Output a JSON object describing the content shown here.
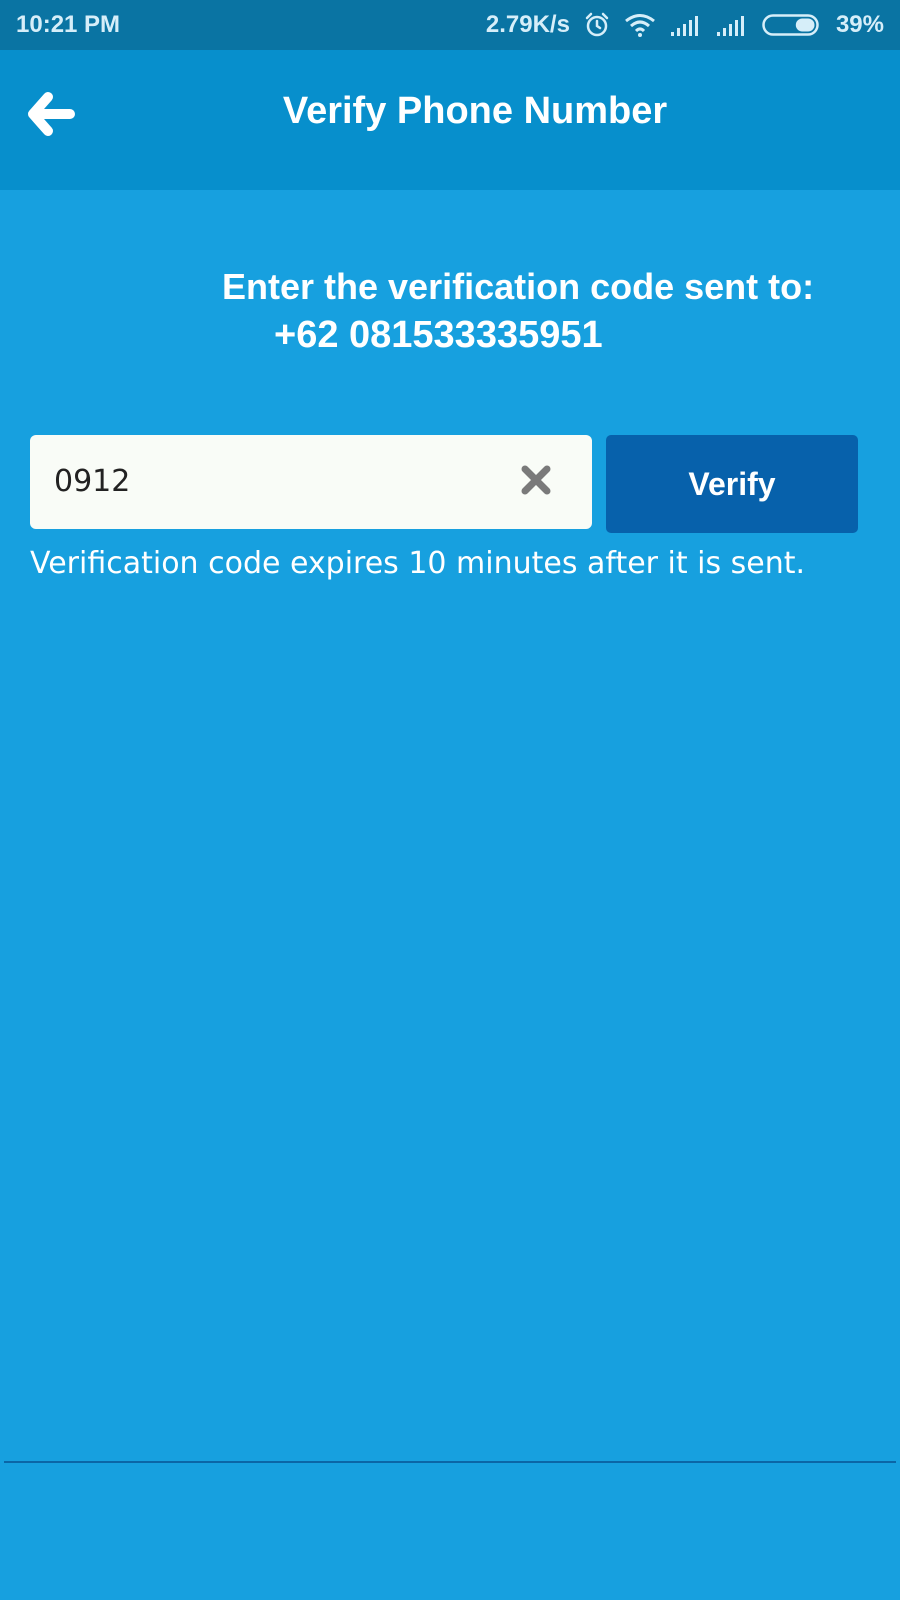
{
  "status_bar": {
    "time": "10:21 PM",
    "network_speed": "2.79K/s",
    "battery_percent": "39%",
    "battery_level": 0.39,
    "icons": [
      "alarm-icon",
      "wifi-icon",
      "signal-icon",
      "signal-icon",
      "battery-icon"
    ]
  },
  "app_bar": {
    "title": "Verify Phone Number",
    "back_icon": "back-arrow-icon"
  },
  "content": {
    "prompt": "Enter the verification code sent to:",
    "phone_number": "+62 081533335951",
    "code_input": {
      "value": "0912",
      "clear_icon": "close-icon"
    },
    "verify_label": "Verify",
    "expiry_note": "Verification code expires 10 minutes after it is sent."
  },
  "colors": {
    "background": "#17a0df",
    "status_bar": "#0a74a3",
    "app_bar": "#078fcc",
    "verify_button": "#0761ab",
    "input_background": "#f9fcf7"
  }
}
